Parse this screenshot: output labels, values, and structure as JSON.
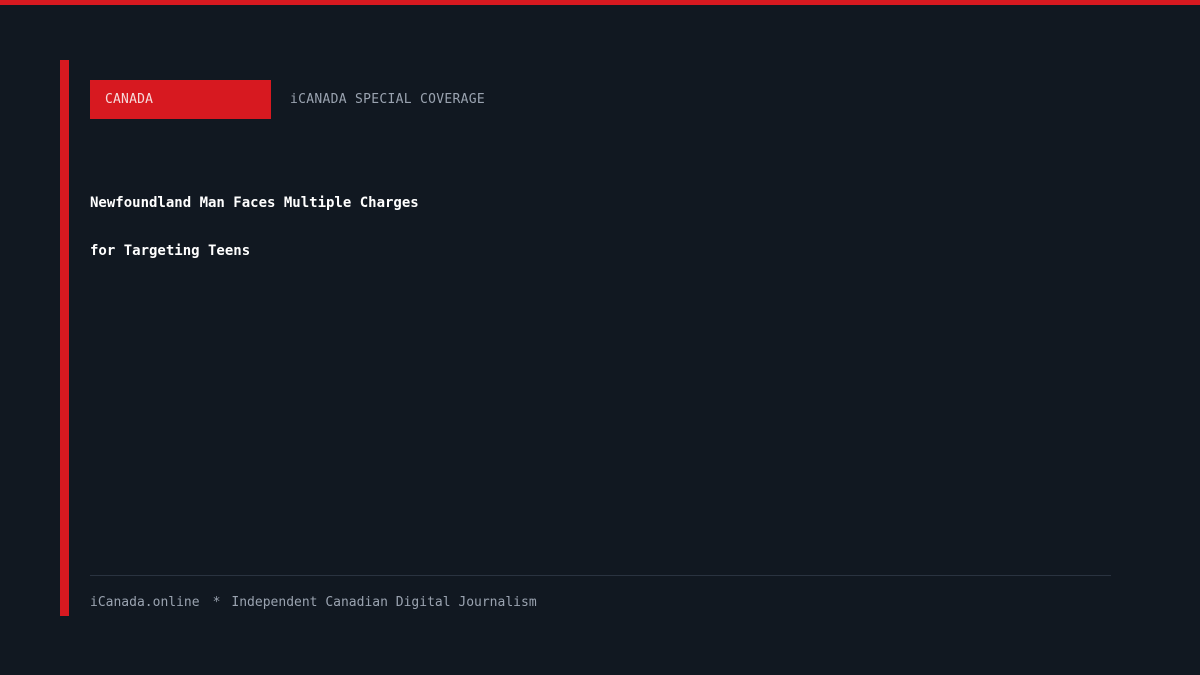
{
  "category_badge": "CANADA",
  "coverage_label": "iCANADA SPECIAL COVERAGE",
  "headline": {
    "line1": "Newfoundland Man Faces Multiple Charges",
    "line2": "for Targeting Teens"
  },
  "footer": {
    "site": "iCanada.online",
    "separator": "*",
    "tagline": "Independent Canadian Digital Journalism"
  },
  "colors": {
    "accent": "#d71920",
    "background": "#111821",
    "muted_text": "#9aa3b0",
    "headline_text": "#ffffff"
  }
}
